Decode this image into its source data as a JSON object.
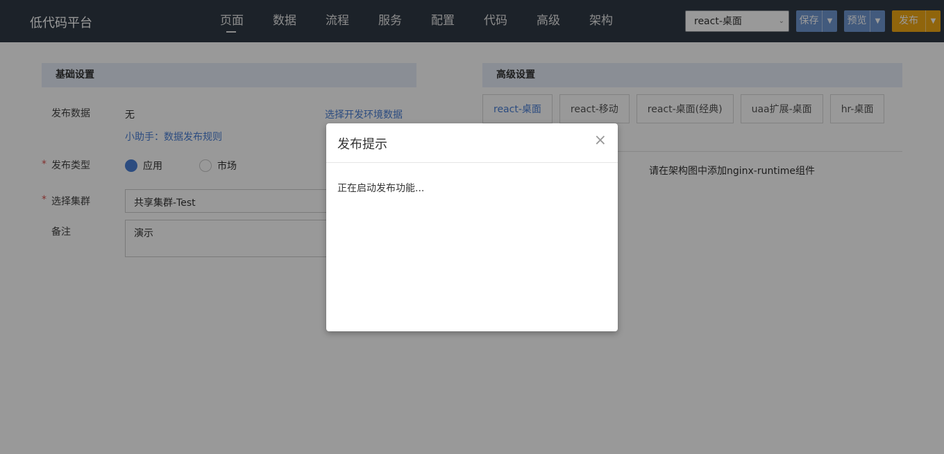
{
  "header": {
    "logo": "低代码平台",
    "nav": [
      "页面",
      "数据",
      "流程",
      "服务",
      "配置",
      "代码",
      "高级",
      "架构"
    ],
    "active_nav": 0,
    "env_select_value": "react-桌面",
    "save_label": "保存",
    "preview_label": "预览",
    "publish_label": "发布"
  },
  "basic": {
    "title": "基础设置",
    "publish_data_label": "发布数据",
    "publish_data_value": "无",
    "select_env_link": "选择开发环境数据",
    "helper_link": "小助手：数据发布规则",
    "publish_type_label": "发布类型",
    "type_option_app": "应用",
    "type_option_market": "市场",
    "cluster_label": "选择集群",
    "cluster_value": "共享集群-Test",
    "note_label": "备注",
    "note_value": "演示",
    "required_mark": "*"
  },
  "advanced": {
    "title": "高级设置",
    "tabs": [
      "react-桌面",
      "react-移动",
      "react-桌面(经典)",
      "uaa扩展-桌面",
      "hr-桌面"
    ],
    "active_tab": 0,
    "hint": "请在架构图中添加nginx-runtime组件"
  },
  "modal": {
    "title": "发布提示",
    "close": "×",
    "message": "正在启动发布功能..."
  },
  "colors": {
    "header_bg": "#2f3a45",
    "primary": "#4a7fd6",
    "publish": "#f0a814"
  }
}
